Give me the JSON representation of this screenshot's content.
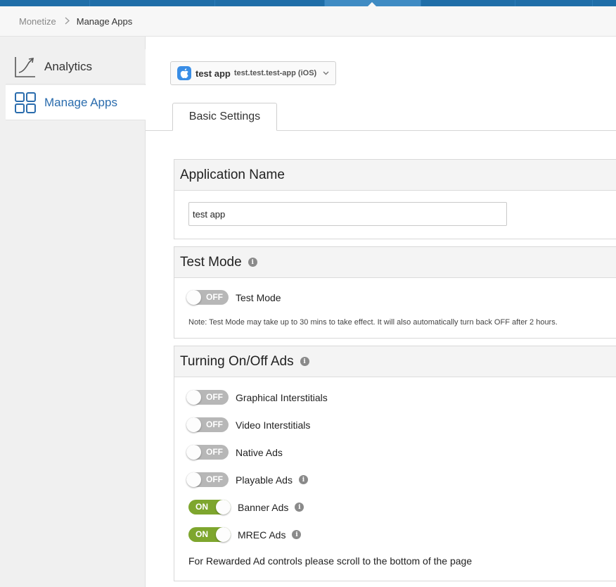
{
  "breadcrumb": {
    "root": "Monetize",
    "separator": ">",
    "current": "Manage Apps"
  },
  "sidebar": {
    "items": [
      {
        "label": "Analytics",
        "icon": "analytics-chart-icon",
        "active": false
      },
      {
        "label": "Manage Apps",
        "icon": "grid-icon",
        "active": true
      }
    ]
  },
  "app_selector": {
    "name": "test app",
    "bundle": "test.test.test-app (iOS)",
    "icon": "apple-icon"
  },
  "tabs": [
    {
      "label": "Basic Settings",
      "active": true
    }
  ],
  "application_name": {
    "title": "Application Name",
    "value": "test app"
  },
  "test_mode": {
    "title": "Test Mode",
    "toggle": {
      "state": "OFF",
      "label": "Test Mode"
    },
    "note": "Note: Test Mode may take up to 30 mins to take effect. It will also automatically turn back OFF after 2 hours."
  },
  "ads": {
    "title": "Turning On/Off Ads",
    "toggles": [
      {
        "label": "Graphical Interstitials",
        "state": "OFF",
        "info": false
      },
      {
        "label": "Video Interstitials",
        "state": "OFF",
        "info": false
      },
      {
        "label": "Native Ads",
        "state": "OFF",
        "info": false
      },
      {
        "label": "Playable Ads",
        "state": "OFF",
        "info": true
      },
      {
        "label": "Banner Ads",
        "state": "ON",
        "info": true
      },
      {
        "label": "MREC Ads",
        "state": "ON",
        "info": true
      }
    ],
    "footer": "For Rewarded Ad controls please scroll to the bottom of the page"
  },
  "colors": {
    "accent": "#2a6cad",
    "toggle_on": "#7ea62e",
    "toggle_off": "#b7b7b7",
    "topbar": "#1f6ea8"
  }
}
